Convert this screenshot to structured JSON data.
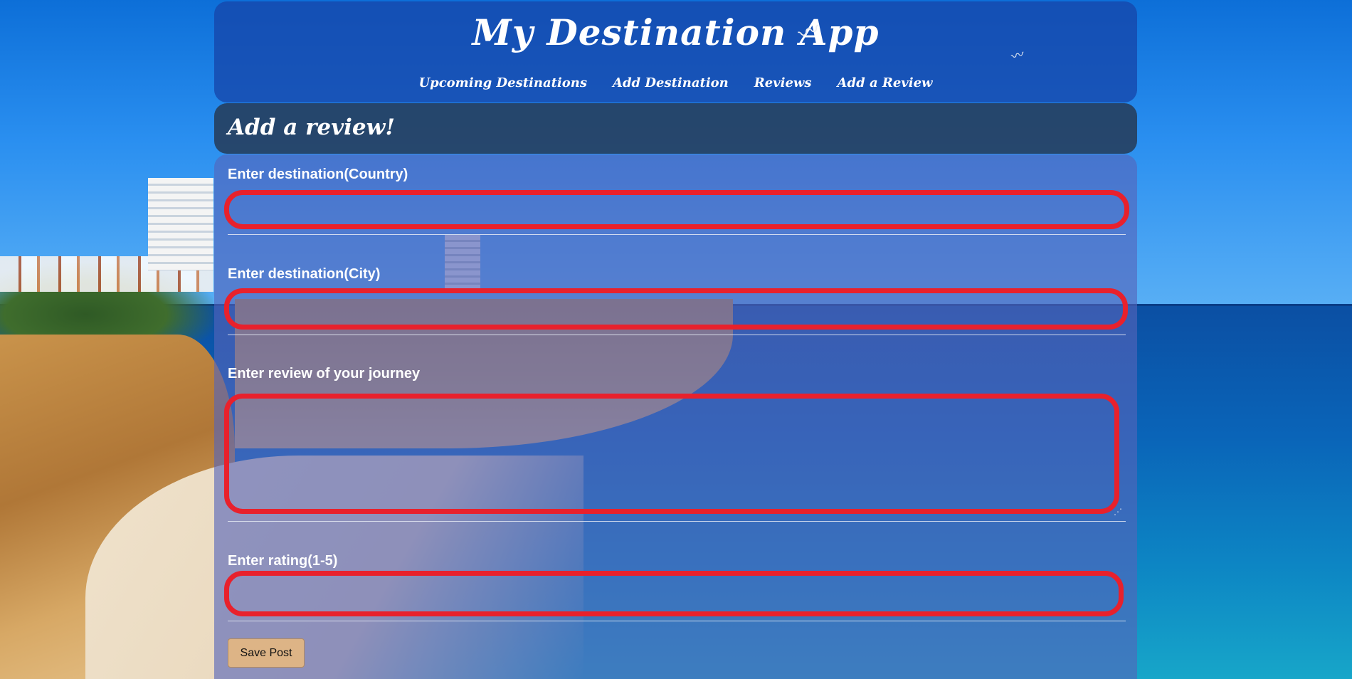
{
  "app": {
    "title": "My Destination App"
  },
  "nav": {
    "items": [
      {
        "label": "Upcoming Destinations"
      },
      {
        "label": "Add Destination"
      },
      {
        "label": "Reviews"
      },
      {
        "label": "Add a Review"
      }
    ]
  },
  "page": {
    "heading": "Add a review!"
  },
  "form": {
    "country": {
      "label": "Enter destination(Country)",
      "value": "",
      "placeholder": ""
    },
    "city": {
      "label": "Enter destination(City)",
      "value": "",
      "placeholder": ""
    },
    "review": {
      "label": "Enter review of your journey",
      "value": "",
      "placeholder": ""
    },
    "rating": {
      "label": "Enter rating(1-5)",
      "value": "",
      "placeholder": ""
    },
    "save_label": "Save Post"
  },
  "colors": {
    "field_highlight": "#e8212c",
    "button_bg": "#ddb486",
    "header_bg": "#1646aa",
    "section_head_bg": "#263c5a"
  },
  "icons": {
    "decor": [
      "seagull-icon",
      "seagull-icon",
      "resize-grip-icon"
    ]
  }
}
